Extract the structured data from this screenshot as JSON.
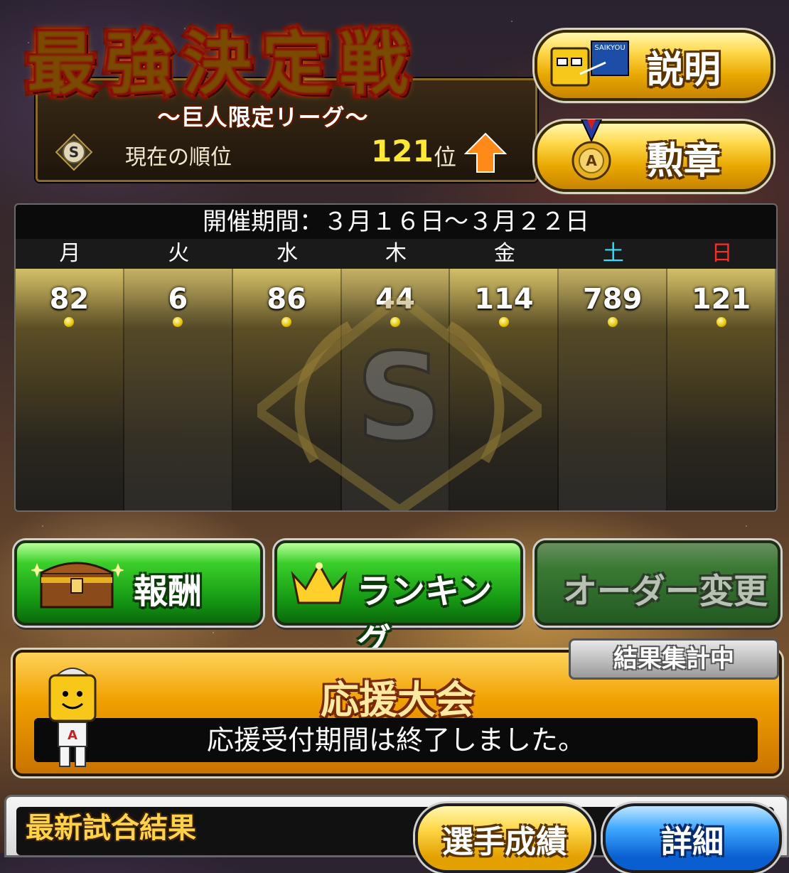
{
  "header": {
    "title": "最強決定戦",
    "subtitle": "〜巨人限定リーグ〜",
    "rank_label": "現在の順位",
    "rank_value": "121",
    "rank_unit": "位",
    "league_badge": "S"
  },
  "buttons": {
    "explain_label": "説明",
    "explain_icon_text": "SAIKYOU",
    "medal_label": "勲章",
    "medal_letter": "A",
    "reward_label": "報酬",
    "ranking_label": "ランキング",
    "order_label": "オーダー変更"
  },
  "calendar": {
    "period": "開催期間：３月１６日〜３月２２日",
    "emblem_letter": "S",
    "days": [
      {
        "day": "月",
        "rank": "82",
        "color": "#ffffff"
      },
      {
        "day": "火",
        "rank": "6",
        "color": "#ffffff"
      },
      {
        "day": "水",
        "rank": "86",
        "color": "#ffffff"
      },
      {
        "day": "木",
        "rank": "44",
        "color": "#ffffff"
      },
      {
        "day": "金",
        "rank": "114",
        "color": "#ffffff"
      },
      {
        "day": "土",
        "rank": "789",
        "color": "#32e0ff"
      },
      {
        "day": "日",
        "rank": "121",
        "color": "#ff2a2a"
      }
    ]
  },
  "support": {
    "status_badge": "結果集計中",
    "title": "応援大会",
    "message": "応援受付期間は終了しました。",
    "mascot_letter": "A"
  },
  "bottom": {
    "latest_result_title": "最新試合結果",
    "player_stats_label": "選手成績",
    "detail_label": "詳細"
  },
  "colors": {
    "rank_number": "#ffe836",
    "saturday": "#32e0ff",
    "sunday": "#ff2a2a",
    "green_button": "#169a14",
    "gold_button": "#e9a800"
  }
}
